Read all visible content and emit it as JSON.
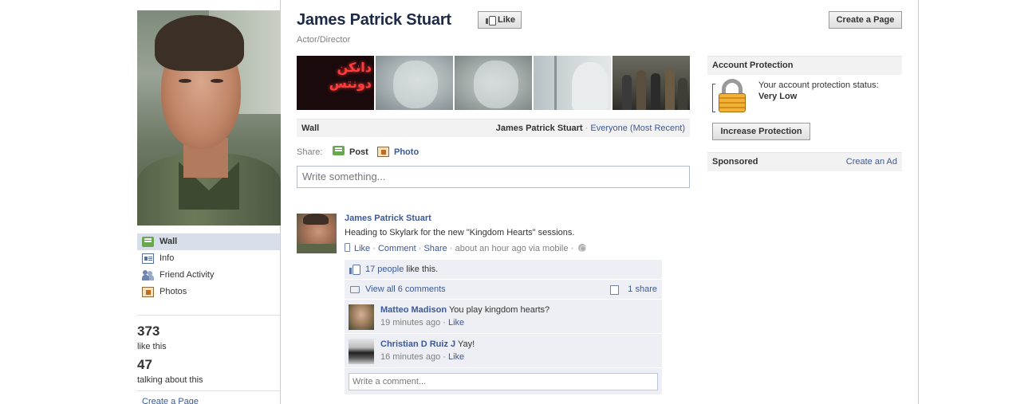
{
  "page": {
    "title": "James Patrick Stuart",
    "category": "Actor/Director",
    "like_button": "Like",
    "create_page_button": "Create a Page"
  },
  "left_nav": {
    "items": [
      {
        "label": "Wall",
        "icon": "wall-icon",
        "active": true
      },
      {
        "label": "Info",
        "icon": "info-icon"
      },
      {
        "label": "Friend Activity",
        "icon": "friends-icon"
      },
      {
        "label": "Photos",
        "icon": "photos-icon"
      }
    ]
  },
  "stats": {
    "likes_count": "373",
    "likes_label": "like this",
    "talking_count": "47",
    "talking_label": "talking about this",
    "create_page_link": "Create a Page"
  },
  "photo_strip": {
    "neon_text": "دانكن دونتس"
  },
  "wall": {
    "title": "Wall",
    "filter_name": "James Patrick Stuart",
    "separator": " · ",
    "filter_link": "Everyone (Most Recent)"
  },
  "share": {
    "label": "Share:",
    "post": "Post",
    "photo": "Photo",
    "placeholder": "Write something..."
  },
  "story": {
    "author": "James Patrick Stuart",
    "text": "Heading to Skylark for the new \"Kingdom Hearts\" sessions.",
    "actions": {
      "like": "Like",
      "comment": "Comment",
      "share": "Share",
      "time": "about an hour ago via mobile",
      "sep": " · "
    },
    "likes": {
      "link": "17 people",
      "text": " like this."
    },
    "view_comments": "View all 6 comments",
    "share_count": "1 share",
    "comments": [
      {
        "name": "Matteo Madison",
        "text": " You play kingdom hearts?",
        "time": "19 minutes ago",
        "like": "Like"
      },
      {
        "name": "Christian D Ruiz J",
        "text": " Yay!",
        "time": "16 minutes ago",
        "like": "Like"
      }
    ],
    "comment_placeholder": "Write a comment..."
  },
  "right_col": {
    "protection": {
      "header": "Account Protection",
      "text": "Your account protection status: ",
      "level": "Very Low",
      "button": "Increase Protection"
    },
    "sponsored": {
      "header": "Sponsored",
      "link": "Create an Ad"
    }
  },
  "colors": {
    "link": "#3b5998",
    "title": "#1c2a47",
    "header_bg": "#f2f2f2",
    "ufi_bg": "#edeff4",
    "nav_active": "#d8dfea"
  }
}
